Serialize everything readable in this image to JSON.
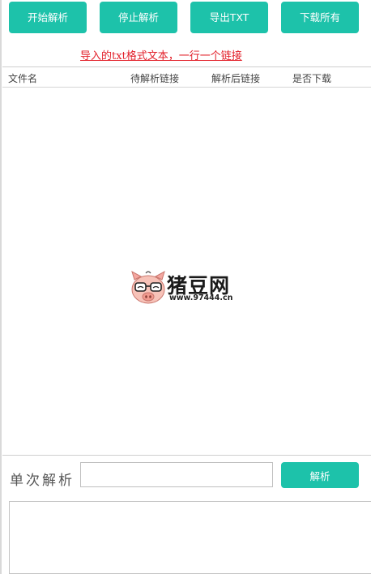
{
  "toolbar": {
    "buttons": [
      {
        "label": "开始解析"
      },
      {
        "label": "停止解析"
      },
      {
        "label": "导出TXT"
      },
      {
        "label": "下载所有"
      }
    ]
  },
  "hint": "导入的txt格式文本，一行一个链接",
  "table": {
    "columns": [
      "文件名",
      "待解析链接",
      "解析后链接",
      "是否下载"
    ],
    "rows": []
  },
  "watermark": {
    "logo_text": "猪豆网",
    "url": "www.97444.cn"
  },
  "single_parse": {
    "label": "单次解析",
    "input_value": "",
    "button_label": "解析"
  },
  "result": {
    "value": ""
  },
  "colors": {
    "accent": "#1dc2aa",
    "hint": "#e2202a"
  }
}
